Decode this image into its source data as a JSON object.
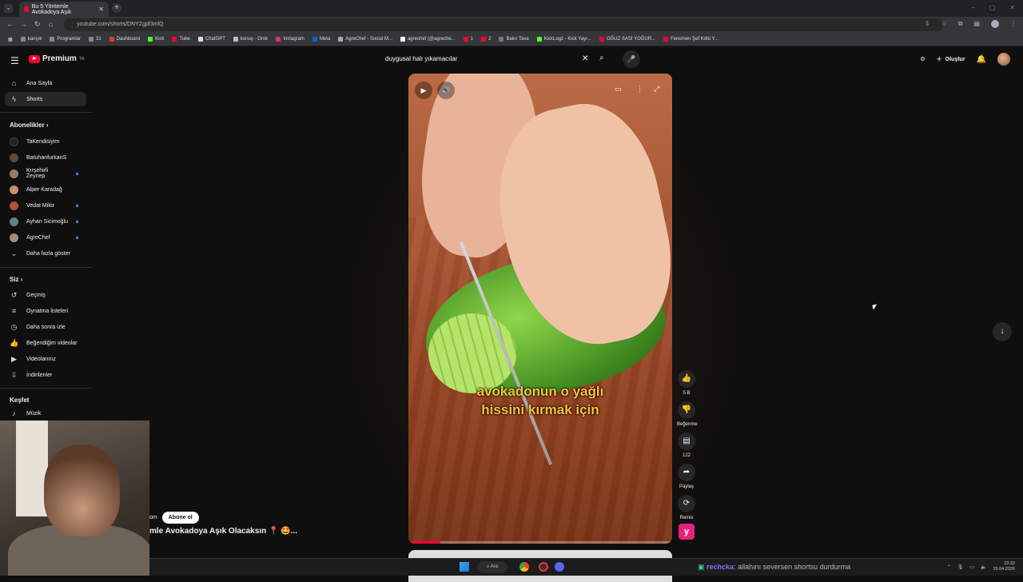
{
  "browser": {
    "tab_title": "Bu 5 Yöntemle Avokadoya Aşık",
    "url": "youtube.com/shorts/DNYZgpf3mlQ",
    "bookmarks": [
      "karışık",
      "Programlar",
      "31",
      "Dashboard",
      "Kick",
      "Tube",
      "ChatGPT",
      "konuş - Grok",
      "Instagram",
      "Meta",
      "AgreChef - Social M...",
      "agrechef (@agreche...",
      "1",
      "2",
      "Bakır Tava",
      "KickLogz - Kick Yayı...",
      "OĞUZ SASİ YOĞUR...",
      "Fenomen Şef Kötü Y..."
    ]
  },
  "header": {
    "logo_text": "Premium",
    "logo_sup": "TR",
    "search_value": "duygusal halı yıkamacılar",
    "create_label": "Oluştur"
  },
  "sidebar": {
    "home": "Ana Sayfa",
    "shorts": "Shorts",
    "subs_title": "Abonelikler",
    "subscriptions": [
      {
        "name": "TaKendisiyim"
      },
      {
        "name": "BatuhanfurkanS"
      },
      {
        "name": "Kırşehirli Zeynep"
      },
      {
        "name": "Alper Karadağ"
      },
      {
        "name": "Vedat Milor"
      },
      {
        "name": "Ayhan Sicimoğlu"
      },
      {
        "name": "AgreChef"
      }
    ],
    "show_more": "Daha fazla göster",
    "you_title": "Siz",
    "you_items": [
      "Geçmiş",
      "Oynatma listeleri",
      "Daha sonra izle",
      "Beğendiğim videolar",
      "Videolarınız",
      "İndirilenler"
    ],
    "explore_title": "Keşfet",
    "explore_items": [
      "Müzik"
    ]
  },
  "video": {
    "caption_line1": "avokadonun o yağlı",
    "caption_line2": "hissini kırmak için",
    "progress": 0.12,
    "channel_suffix": "om",
    "subscribe_label": "Abone ol",
    "title": "mle Avokadoya Aşık Olacaksın 📍 🤩..."
  },
  "actions": {
    "likes": "5 B",
    "dislike_label": "Beğenme",
    "comments": "122",
    "share_label": "Paylaş",
    "remix_label": "Remix"
  },
  "taskbar": {
    "search_label": "Ara",
    "chat_user": "rechcka",
    "chat_message": ": allahını seversen shortsu durdurma",
    "time": "23:32",
    "date": "15.04.2026"
  }
}
